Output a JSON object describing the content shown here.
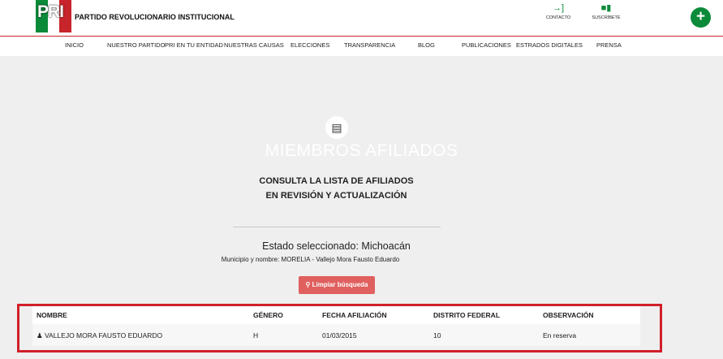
{
  "header": {
    "logo_text": "PRI",
    "party_name": "PARTIDO REVOLUCIONARIO INSTITUCIONAL",
    "links": [
      {
        "label": "CONTACTO",
        "icon": "sign-in-icon"
      },
      {
        "label": "SUSCRÍBETE",
        "icon": "id-card-icon"
      }
    ],
    "plus_label": "+"
  },
  "nav": [
    "INICIO",
    "NUESTRO PARTIDO",
    "PRI EN TU ENTIDAD",
    "NUESTRAS CAUSAS",
    "ELECCIONES",
    "TRANSPARENCIA",
    "BLOG",
    "PUBLICACIONES",
    "ESTRADOS DIGITALES",
    "PRENSA"
  ],
  "main": {
    "badge_icon": "id-badge-icon",
    "title": "MIEMBROS AFILIADOS",
    "subtitle_line1": "CONSULTA LA LISTA DE AFILIADOS",
    "subtitle_line2": "EN REVISIÓN Y ACTUALIZACIÓN",
    "state_label": "Estado seleccionado: Michoacán",
    "municipality_label": "Municipio y nombre: MORELIA - Vallejo Mora Fausto Eduardo",
    "clear_button": "Limpiar búsqueda"
  },
  "table": {
    "headers": [
      "NOMBRE",
      "GÉNERO",
      "FECHA AFILIACIÓN",
      "DISTRITO FEDERAL",
      "OBSERVACIÓN"
    ],
    "rows": [
      [
        "VALLEJO MORA FAUSTO EDUARDO",
        "H",
        "01/03/2015",
        "10",
        "En reserva"
      ]
    ]
  },
  "colors": {
    "brand_green": "#0b8a3a",
    "brand_red": "#c8242b",
    "button_red": "#e05f5f",
    "highlight_red": "#d0202a"
  }
}
